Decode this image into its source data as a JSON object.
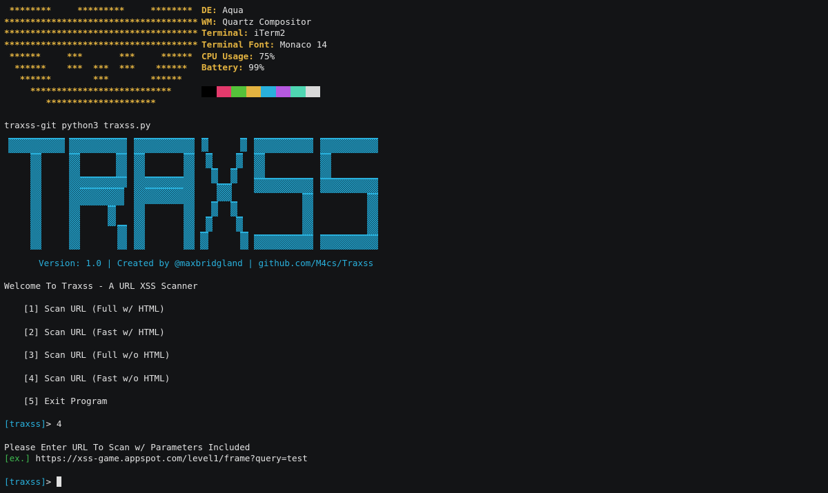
{
  "ascii_art": [
    " ********     *********     ********",
    "*************************************",
    "*************************************",
    "*************************************",
    " ******     ***       ***     ******",
    "  ******    ***  ***  ***    ******",
    "   ******        ***        ******",
    "     ***************************",
    "        *********************"
  ],
  "sysinfo": [
    {
      "key": "DE",
      "value": "Aqua"
    },
    {
      "key": "WM",
      "value": "Quartz Compositor"
    },
    {
      "key": "Terminal",
      "value": "iTerm2"
    },
    {
      "key": "Terminal Font",
      "value": "Monaco 14"
    },
    {
      "key": "CPU Usage",
      "value": "75%"
    },
    {
      "key": "Battery",
      "value": "99%"
    }
  ],
  "palette": [
    "#000000",
    "#e43a6c",
    "#55c13a",
    "#e3b341",
    "#29b0dc",
    "#b65ae0",
    "#4fd6b2",
    "#d9d9d9"
  ],
  "command": "traxss-git python3 traxss.py",
  "logo": {
    "text": "TRAXSS",
    "color": "#29b0dc"
  },
  "version_line": "Version: 1.0 | Created by @maxbridgland | github.com/M4cs/Traxss",
  "welcome": "Welcome To Traxss - A URL XSS Scanner",
  "menu": [
    "[1] Scan URL (Full w/ HTML)",
    "[2] Scan URL (Fast w/ HTML)",
    "[3] Scan URL (Full w/o HTML)",
    "[4] Scan URL (Fast w/o HTML)",
    "[5] Exit Program"
  ],
  "prompt": {
    "label": "[traxss]",
    "arrow": "> "
  },
  "first_input": "4",
  "url_request": "Please Enter URL To Scan w/ Parameters Included",
  "example": {
    "label": "[ex.]",
    "url": " https://xss-game.appspot.com/level1/frame?query=test"
  }
}
